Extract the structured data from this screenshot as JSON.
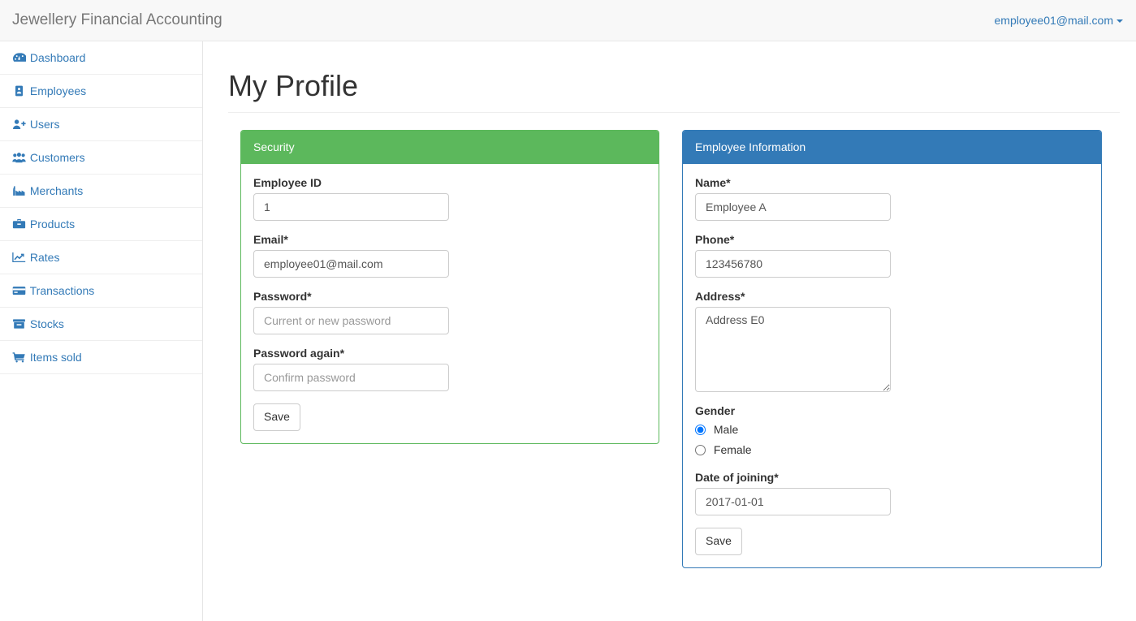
{
  "navbar": {
    "brand": "Jewellery Financial Accounting",
    "user_menu": {
      "label": "employee01@mail.com",
      "icon": "caret-down-icon"
    }
  },
  "sidebar": {
    "items": [
      {
        "label": "Dashboard",
        "icon": "dashboard-icon"
      },
      {
        "label": "Employees",
        "icon": "id-badge-icon"
      },
      {
        "label": "Users",
        "icon": "user-plus-icon"
      },
      {
        "label": "Customers",
        "icon": "users-group-icon"
      },
      {
        "label": "Merchants",
        "icon": "industry-icon"
      },
      {
        "label": "Products",
        "icon": "briefcase-icon"
      },
      {
        "label": "Rates",
        "icon": "line-chart-icon"
      },
      {
        "label": "Transactions",
        "icon": "credit-card-icon"
      },
      {
        "label": "Stocks",
        "icon": "archive-icon"
      },
      {
        "label": "Items sold",
        "icon": "shopping-cart-icon"
      }
    ]
  },
  "main": {
    "page_title": "My Profile",
    "security_panel": {
      "heading": "Security",
      "accent_color": "#5cb85c",
      "fields": {
        "employee_id": {
          "label": "Employee ID",
          "value": "1",
          "placeholder": ""
        },
        "email": {
          "label": "Email*",
          "value": "employee01@mail.com",
          "placeholder": ""
        },
        "password": {
          "label": "Password*",
          "value": "",
          "placeholder": "Current or new password"
        },
        "password_again": {
          "label": "Password again*",
          "value": "",
          "placeholder": "Confirm password"
        }
      },
      "save_label": "Save"
    },
    "employee_panel": {
      "heading": "Employee Information",
      "accent_color": "#337ab7",
      "fields": {
        "name": {
          "label": "Name*",
          "value": "Employee A",
          "placeholder": ""
        },
        "phone": {
          "label": "Phone*",
          "value": "123456780",
          "placeholder": ""
        },
        "address": {
          "label": "Address*",
          "value": "Address E0",
          "placeholder": ""
        },
        "gender": {
          "label": "Gender",
          "options": [
            {
              "label": "Male",
              "selected": true
            },
            {
              "label": "Female",
              "selected": false
            }
          ]
        },
        "date_of_joining": {
          "label": "Date of joining*",
          "value": "2017-01-01",
          "placeholder": ""
        }
      },
      "save_label": "Save"
    }
  }
}
